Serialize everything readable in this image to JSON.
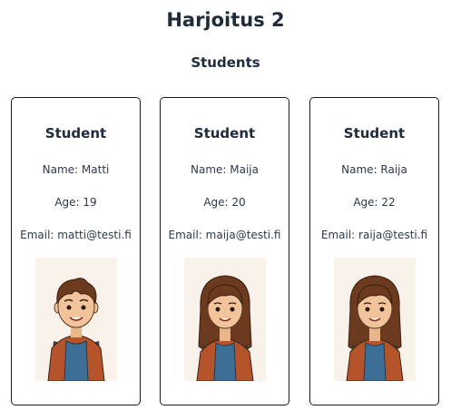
{
  "page": {
    "title": "Harjoitus 2",
    "section_title": "Students"
  },
  "students": [
    {
      "card_title": "Student",
      "name_line": "Name: Matti",
      "age_line": "Age: 19",
      "email_line": "Email: matti@testi.fi",
      "avatar_icon": "boy-student-avatar"
    },
    {
      "card_title": "Student",
      "name_line": "Name: Maija",
      "age_line": "Age: 20",
      "email_line": "Email: maija@testi.fi",
      "avatar_icon": "girl-student-avatar"
    },
    {
      "card_title": "Student",
      "name_line": "Name: Raija",
      "age_line": "Age: 22",
      "email_line": "Email: raija@testi.fi",
      "avatar_icon": "girl-student-avatar"
    }
  ],
  "colors": {
    "hair": "#6b3a1f",
    "skin": "#f2c49b",
    "jacket": "#b5532a",
    "shirt": "#3d6e96",
    "strap": "#3a3a3a",
    "avatar_bg": "#f8f2ea"
  }
}
